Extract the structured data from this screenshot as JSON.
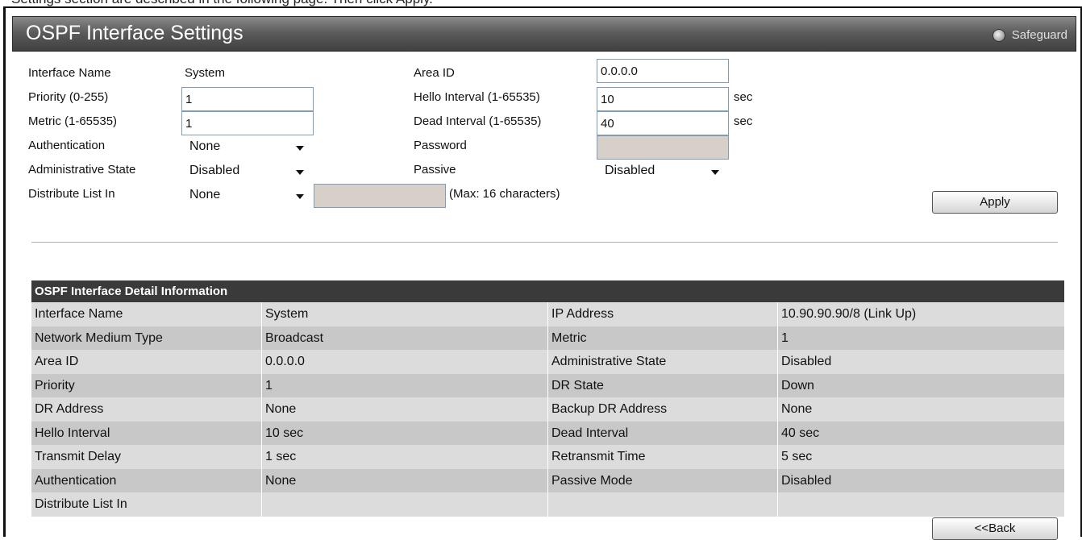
{
  "top_strip_text": "Settings section are described in the following page. Then click Apply.",
  "title": "OSPF Interface Settings",
  "safeguard_label": "Safeguard",
  "form": {
    "interface_name_label": "Interface Name",
    "interface_name_value": "System",
    "priority_label": "Priority (0-255)",
    "priority_value": "1",
    "metric_label": "Metric (1-65535)",
    "metric_value": "1",
    "authentication_label": "Authentication",
    "authentication_value": "None",
    "admin_state_label": "Administrative State",
    "admin_state_value": "Disabled",
    "distribute_list_label": "Distribute List In",
    "distribute_list_value": "None",
    "distribute_list_text": "",
    "distribute_list_hint": "(Max: 16 characters)",
    "area_id_label": "Area ID",
    "area_id_value": "0.0.0.0",
    "hello_label": "Hello Interval (1-65535)",
    "hello_value": "10",
    "hello_unit": "sec",
    "dead_label": "Dead Interval (1-65535)",
    "dead_value": "40",
    "dead_unit": "sec",
    "password_label": "Password",
    "password_value": "",
    "passive_label": "Passive",
    "passive_value": "Disabled",
    "apply_label": "Apply"
  },
  "detail": {
    "header": "OSPF Interface Detail Information",
    "rows": [
      [
        "Interface Name",
        "System",
        "IP Address",
        "10.90.90.90/8 (Link Up)"
      ],
      [
        "Network Medium Type",
        "Broadcast",
        "Metric",
        "1"
      ],
      [
        "Area ID",
        "0.0.0.0",
        "Administrative State",
        "Disabled"
      ],
      [
        "Priority",
        "1",
        "DR State",
        "Down"
      ],
      [
        "DR Address",
        "None",
        "Backup DR Address",
        "None"
      ],
      [
        "Hello Interval",
        "10 sec",
        "Dead Interval",
        "40 sec"
      ],
      [
        "Transmit Delay",
        "1 sec",
        "Retransmit Time",
        "5 sec"
      ],
      [
        "Authentication",
        "None",
        "Passive Mode",
        "Disabled"
      ],
      [
        "Distribute List In",
        "",
        "",
        ""
      ]
    ],
    "back_label": "<<Back"
  }
}
